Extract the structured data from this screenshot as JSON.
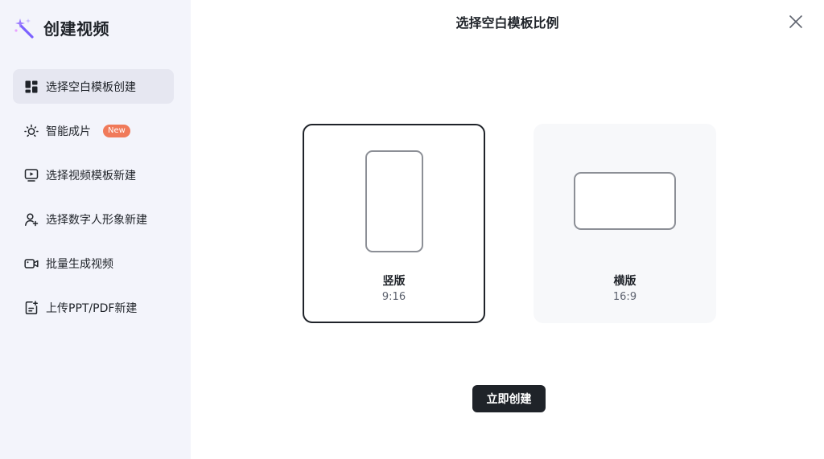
{
  "sidebar": {
    "brand_title": "创建视频",
    "brand_icon": "magic-wand-icon",
    "items": [
      {
        "label": "选择空白模板创建",
        "icon": "grid-layout-icon",
        "active": true
      },
      {
        "label": "智能成片",
        "icon": "sparkle-sun-icon",
        "badge": "New"
      },
      {
        "label": "选择视频模板新建",
        "icon": "video-play-icon"
      },
      {
        "label": "选择数字人形象新建",
        "icon": "user-add-icon"
      },
      {
        "label": "批量生成视频",
        "icon": "video-camera-icon"
      },
      {
        "label": "上传PPT/PDF新建",
        "icon": "document-upload-icon"
      }
    ]
  },
  "dialog": {
    "title": "选择空白模板比例",
    "close_icon": "close-icon",
    "options": [
      {
        "label": "竖版",
        "ratio": "9:16",
        "selected": true
      },
      {
        "label": "横版",
        "ratio": "16:9",
        "selected": false
      }
    ],
    "create_label": "立即创建"
  },
  "colors": {
    "sidebar_bg": "#f3f4fb",
    "active_item_bg": "#e6e7f1",
    "badge_bg": "#f07a5a",
    "primary_button": "#1f2329",
    "brand_purple": "#7b61ff"
  }
}
